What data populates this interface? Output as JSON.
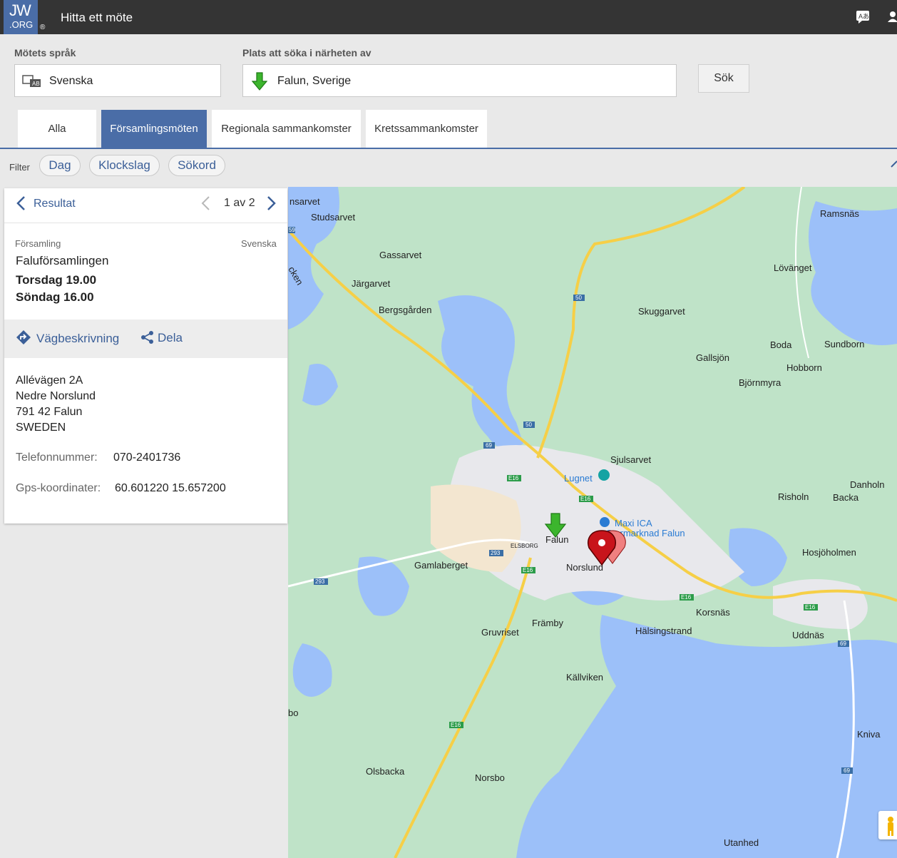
{
  "header": {
    "logo_top": "JW",
    "logo_bottom": ".ORG",
    "registered": "®",
    "title": "Hitta ett möte",
    "icon_language": "translate-icon",
    "icon_user": "user-icon"
  },
  "search": {
    "language_label": "Mötets språk",
    "language_value": "Svenska",
    "location_label": "Plats att söka i närheten av",
    "location_value": "Falun, Sverige",
    "search_button": "Sök"
  },
  "tabs": [
    {
      "label": "Alla",
      "active": false
    },
    {
      "label": "Församlingsmöten",
      "active": true
    },
    {
      "label": "Regionala sammankomster",
      "active": false
    },
    {
      "label": "Kretssammankomster",
      "active": false
    }
  ],
  "filter": {
    "label": "Filter",
    "chips": [
      "Dag",
      "Klockslag",
      "Sökord"
    ]
  },
  "result": {
    "back_label": "Resultat",
    "pagination": "1 av 2",
    "type": "Församling",
    "language": "Svenska",
    "name": "Faluförsamlingen",
    "times": [
      "Torsdag 19.00",
      "Söndag 16.00"
    ],
    "directions_label": "Vägbeskrivning",
    "share_label": "Dela",
    "address": [
      "Allévägen 2A",
      "Nedre Norslund",
      "791 42  Falun",
      "SWEDEN"
    ],
    "phone_label": "Telefonnummer:",
    "phone": "070-2401736",
    "gps_label": "Gps-koordinater:",
    "gps": "60.601220 15.657200"
  },
  "map": {
    "places": [
      "nsarvet",
      "Studsarvet",
      "Gassarvet",
      "Järgarvet",
      "Bergsgården",
      "Ramsnäs",
      "Lövänget",
      "Skuggarvet",
      "Gallsjön",
      "Boda",
      "Sundborn",
      "Hobborn",
      "Björnmyra",
      "Sjulsarvet",
      "Lugnet",
      "Maxi ICA",
      "Stormarknad Falun",
      "Danholn",
      "Risholn",
      "Backa",
      "Falun",
      "ELSBORG",
      "Norslund",
      "Hosjöholmen",
      "Gamlaberget",
      "Korsnäs",
      "Främby",
      "Hälsingstrand",
      "Uddnäs",
      "Gruvriset",
      "Källviken",
      "Kniva",
      "Olsbacka",
      "Norsbo",
      "Utanhed",
      "cken",
      "bo"
    ],
    "road_labels": [
      "59",
      "50",
      "50",
      "69",
      "E16",
      "E16",
      "293",
      "E16",
      "293",
      "E16",
      "E16",
      "69",
      "E16",
      "69"
    ]
  }
}
